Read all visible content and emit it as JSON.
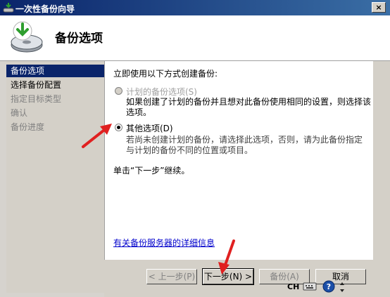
{
  "window": {
    "title": "一次性备份向导",
    "close_symbol": "×"
  },
  "header": {
    "title": "备份选项"
  },
  "sidebar": {
    "items": [
      {
        "label": "备份选项"
      },
      {
        "label": "选择备份配置"
      },
      {
        "label": "指定目标类型"
      },
      {
        "label": "确认"
      },
      {
        "label": "备份进度"
      }
    ]
  },
  "content": {
    "intro": "立即使用以下方式创建备份:",
    "option_scheduled": {
      "label": "计划的备份选项(S)",
      "description": "如果创建了计划的备份并且想对此备份使用相同的设置，则选择该选项。"
    },
    "option_other": {
      "label": "其他选项(D)",
      "description": "若尚未创建计划的备份，请选择此选项，否则，请为此备份指定与计划的备份不同的位置或项目。"
    },
    "hint": "单击“下一步”继续。",
    "link": "有关备份服务器的详细信息"
  },
  "footer": {
    "back": "< 上一步(P)",
    "next": "下一步(N) >",
    "backup": "备份(A)",
    "cancel": "取消"
  },
  "tray": {
    "language": "CH"
  },
  "colors": {
    "selection": "#0a246a",
    "link": "#0000cc",
    "annotation_arrow": "#e02020"
  }
}
